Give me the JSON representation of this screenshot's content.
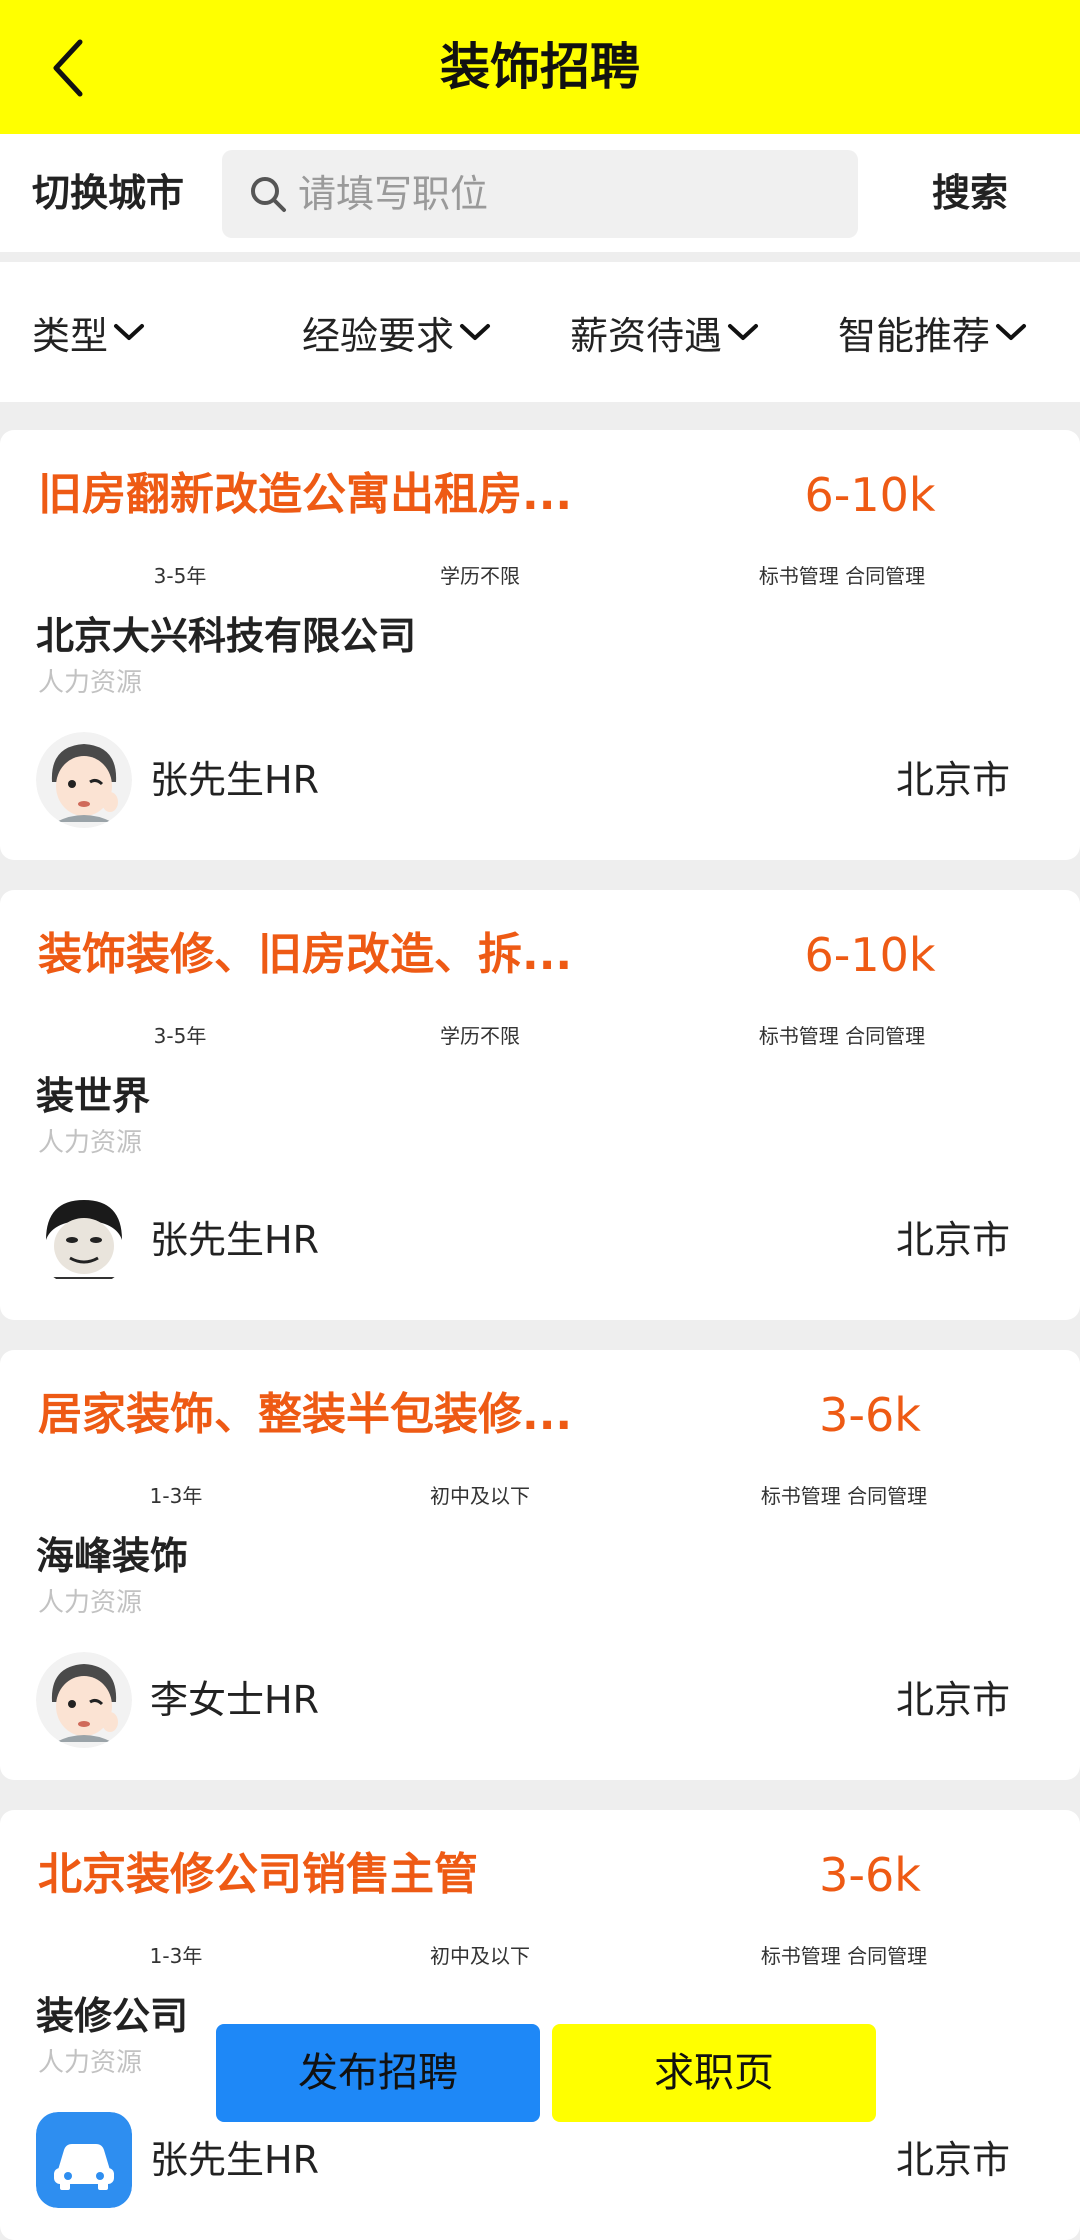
{
  "header": {
    "title": "装饰招聘",
    "back_icon": "chevron-left-icon",
    "background": "#ffff00"
  },
  "search": {
    "city_switch_label": "切换城市",
    "placeholder": "请填写职位",
    "value": "",
    "button_label": "搜索",
    "icon": "search-icon"
  },
  "filters": [
    {
      "label": "类型",
      "icon": "chevron-down-icon"
    },
    {
      "label": "经验要求",
      "icon": "chevron-down-icon"
    },
    {
      "label": "薪资待遇",
      "icon": "chevron-down-icon"
    },
    {
      "label": "智能推荐",
      "icon": "chevron-down-icon"
    }
  ],
  "jobs": [
    {
      "title": "旧房翻新改造公寓出租房...",
      "salary": "6-10k",
      "experience": "3-5年",
      "education": "学历不限",
      "skills": "标书管理 合同管理",
      "company": "北京大兴科技有限公司",
      "department": "人力资源",
      "hr_name": "张先生HR",
      "city": "北京市",
      "avatar": "cartoon-face-avatar"
    },
    {
      "title": "装饰装修、旧房改造、拆...",
      "salary": "6-10k",
      "experience": "3-5年",
      "education": "学历不限",
      "skills": "标书管理 合同管理",
      "company": "装世界",
      "department": "人力资源",
      "hr_name": "张先生HR",
      "city": "北京市",
      "avatar": "meme-face-avatar"
    },
    {
      "title": "居家装饰、整装半包装修...",
      "salary": "3-6k",
      "experience": "1-3年",
      "education": "初中及以下",
      "skills": "标书管理 合同管理",
      "company": "海峰装饰",
      "department": "人力资源",
      "hr_name": "李女士HR",
      "city": "北京市",
      "avatar": "cartoon-face-avatar"
    },
    {
      "title": "北京装修公司销售主管",
      "salary": "3-6k",
      "experience": "1-3年",
      "education": "初中及以下",
      "skills": "标书管理 合同管理",
      "company": "装修公司",
      "department": "人力资源",
      "hr_name": "张先生HR",
      "city": "北京市",
      "avatar": "car-app-avatar"
    }
  ],
  "bottom_actions": {
    "post_job_label": "发布招聘",
    "seek_job_label": "求职页",
    "post_job_color": "#1e88f7",
    "seek_job_color": "#ffff00"
  },
  "colors": {
    "accent": "#ee5a14",
    "header_bg": "#ffff00",
    "page_bg": "#eeeeee"
  }
}
